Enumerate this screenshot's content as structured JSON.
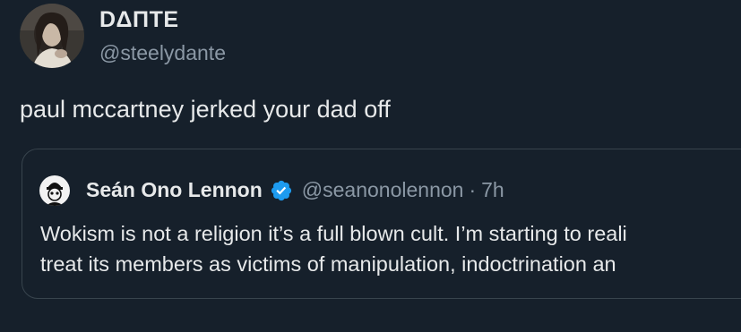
{
  "tweet": {
    "display_name": "DΔΠTE",
    "handle": "@steelydante",
    "text": "paul mccartney jerked your dad off",
    "avatar_icon": "profile-photo-icon"
  },
  "quoted_tweet": {
    "display_name": "Seán Ono Lennon",
    "verified_icon": "verified-badge-icon",
    "verified_color": "#1d9bf0",
    "handle": "@seanonolennon",
    "separator": "·",
    "time": "7h",
    "lines": [
      "Wokism is not a religion it’s a full blown cult. I’m starting to reali",
      "treat its members as victims of manipulation, indoctrination an"
    ]
  },
  "colors": {
    "background": "#16202b",
    "text_primary": "#e7e9ea",
    "text_secondary": "#8b98a5",
    "border": "#38444d"
  }
}
